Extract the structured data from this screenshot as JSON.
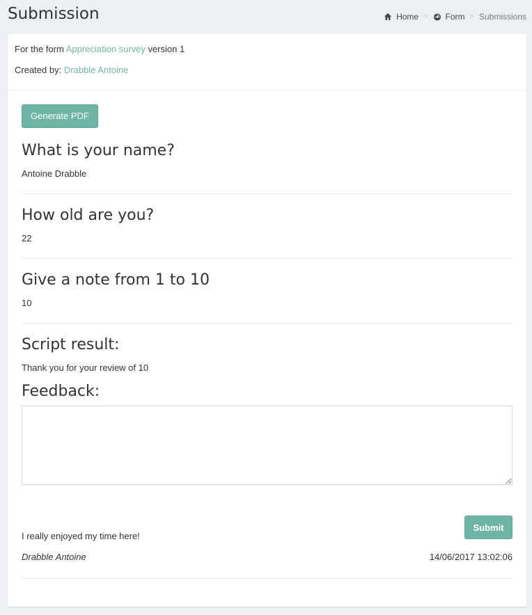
{
  "header": {
    "title": "Submission",
    "breadcrumb": {
      "home": "Home",
      "form": "Form",
      "current": "Submissions"
    }
  },
  "meta": {
    "form_prefix": "For the form ",
    "form_name": "Appreciation survey",
    "version_text": " version 1",
    "created_by_label": "Created by: ",
    "created_by_name": "Drabble Antoine"
  },
  "actions": {
    "generate_pdf": "Generate PDF"
  },
  "questions": [
    {
      "title": "What is your name?",
      "answer": "Antoine Drabble"
    },
    {
      "title": "How old are you?",
      "answer": "22"
    },
    {
      "title": "Give a note from 1 to 10",
      "answer": "10"
    }
  ],
  "script": {
    "title": "Script result:",
    "result": "Thank you for your review of 10"
  },
  "feedback": {
    "title": "Feedback:",
    "value": "",
    "submit_label": "Submit"
  },
  "comment": {
    "text": "I really enjoyed my time here!",
    "author": "Drabble Antoine",
    "date": "14/06/2017 13:02:06"
  },
  "colors": {
    "accent": "#6fb5a6",
    "link": "#74b4a6",
    "background": "#ecf0f5"
  },
  "icons": {
    "home": "home-icon",
    "form": "dashboard-icon"
  }
}
